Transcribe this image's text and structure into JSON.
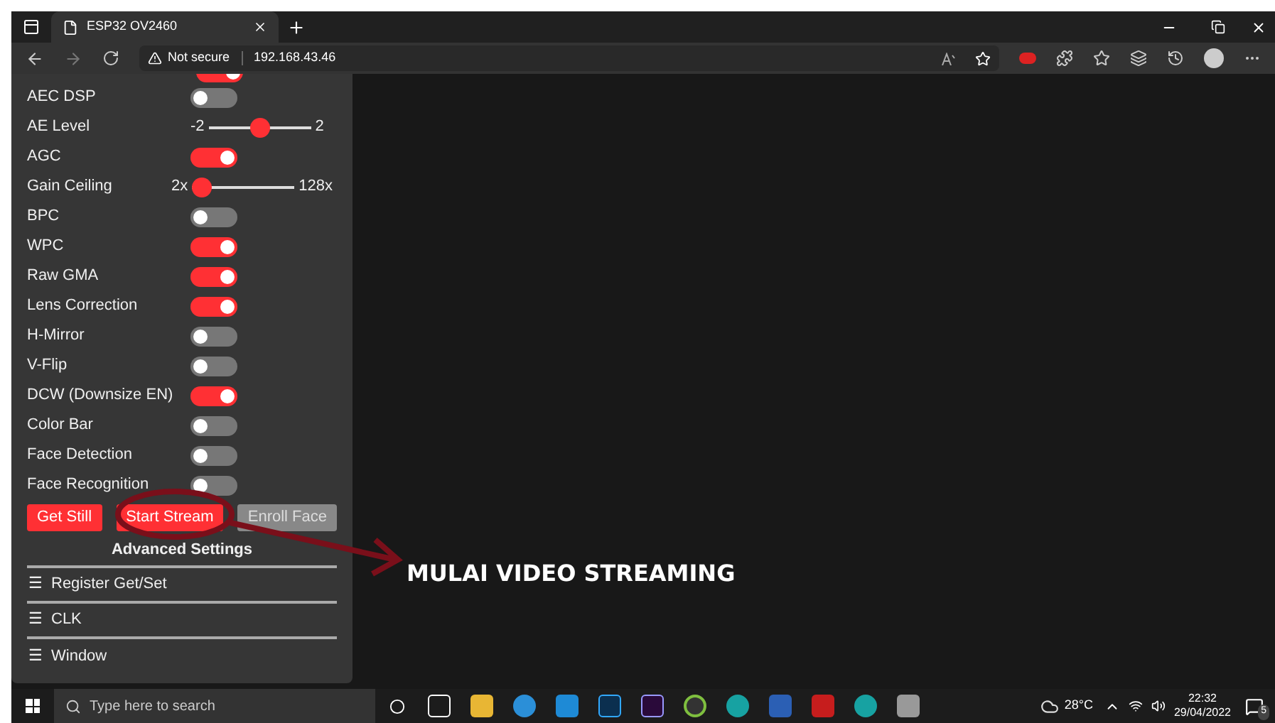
{
  "browser": {
    "tab_title": "ESP32 OV2460",
    "security": "Not secure",
    "url": "192.168.43.46"
  },
  "controls": [
    {
      "kind": "toggle",
      "on": true
    },
    {
      "kind": "toggle",
      "label": "AEC DSP",
      "on": false
    },
    {
      "kind": "slider",
      "label": "AE Level",
      "min": "-2",
      "max": "2",
      "level": 0.5
    },
    {
      "kind": "toggle",
      "label": "AGC",
      "on": true
    },
    {
      "kind": "slider",
      "label": "Gain Ceiling",
      "min": "2x",
      "max": "128x",
      "level": 0
    },
    {
      "kind": "toggle",
      "label": "BPC",
      "on": false
    },
    {
      "kind": "toggle",
      "label": "WPC",
      "on": true
    },
    {
      "kind": "toggle",
      "label": "Raw GMA",
      "on": true
    },
    {
      "kind": "toggle",
      "label": "Lens Correction",
      "on": true
    },
    {
      "kind": "toggle",
      "label": "H-Mirror",
      "on": false
    },
    {
      "kind": "toggle",
      "label": "V-Flip",
      "on": false
    },
    {
      "kind": "toggle",
      "label": "DCW (Downsize EN)",
      "on": true
    },
    {
      "kind": "toggle",
      "label": "Color Bar",
      "on": false
    },
    {
      "kind": "toggle",
      "label": "Face Detection",
      "on": false
    },
    {
      "kind": "toggle",
      "label": "Face Recognition",
      "on": false
    }
  ],
  "buttons": [
    {
      "label": "Get Still",
      "disabled": false
    },
    {
      "label": "Start Stream",
      "disabled": false
    },
    {
      "label": "Enroll Face",
      "disabled": true
    }
  ],
  "advanced_title": "Advanced Settings",
  "sections": [
    {
      "icon": "☰",
      "label": "Register Get/Set"
    },
    {
      "icon": "☰",
      "label": "CLK"
    },
    {
      "icon": "☰",
      "label": "Window"
    }
  ],
  "annotation": "MULAI VIDEO STREAMING",
  "taskbar": {
    "search_placeholder": "Type here to search",
    "temperature": "28°C",
    "time": "22:32",
    "date": "29/04/2022",
    "notifications": "5"
  }
}
